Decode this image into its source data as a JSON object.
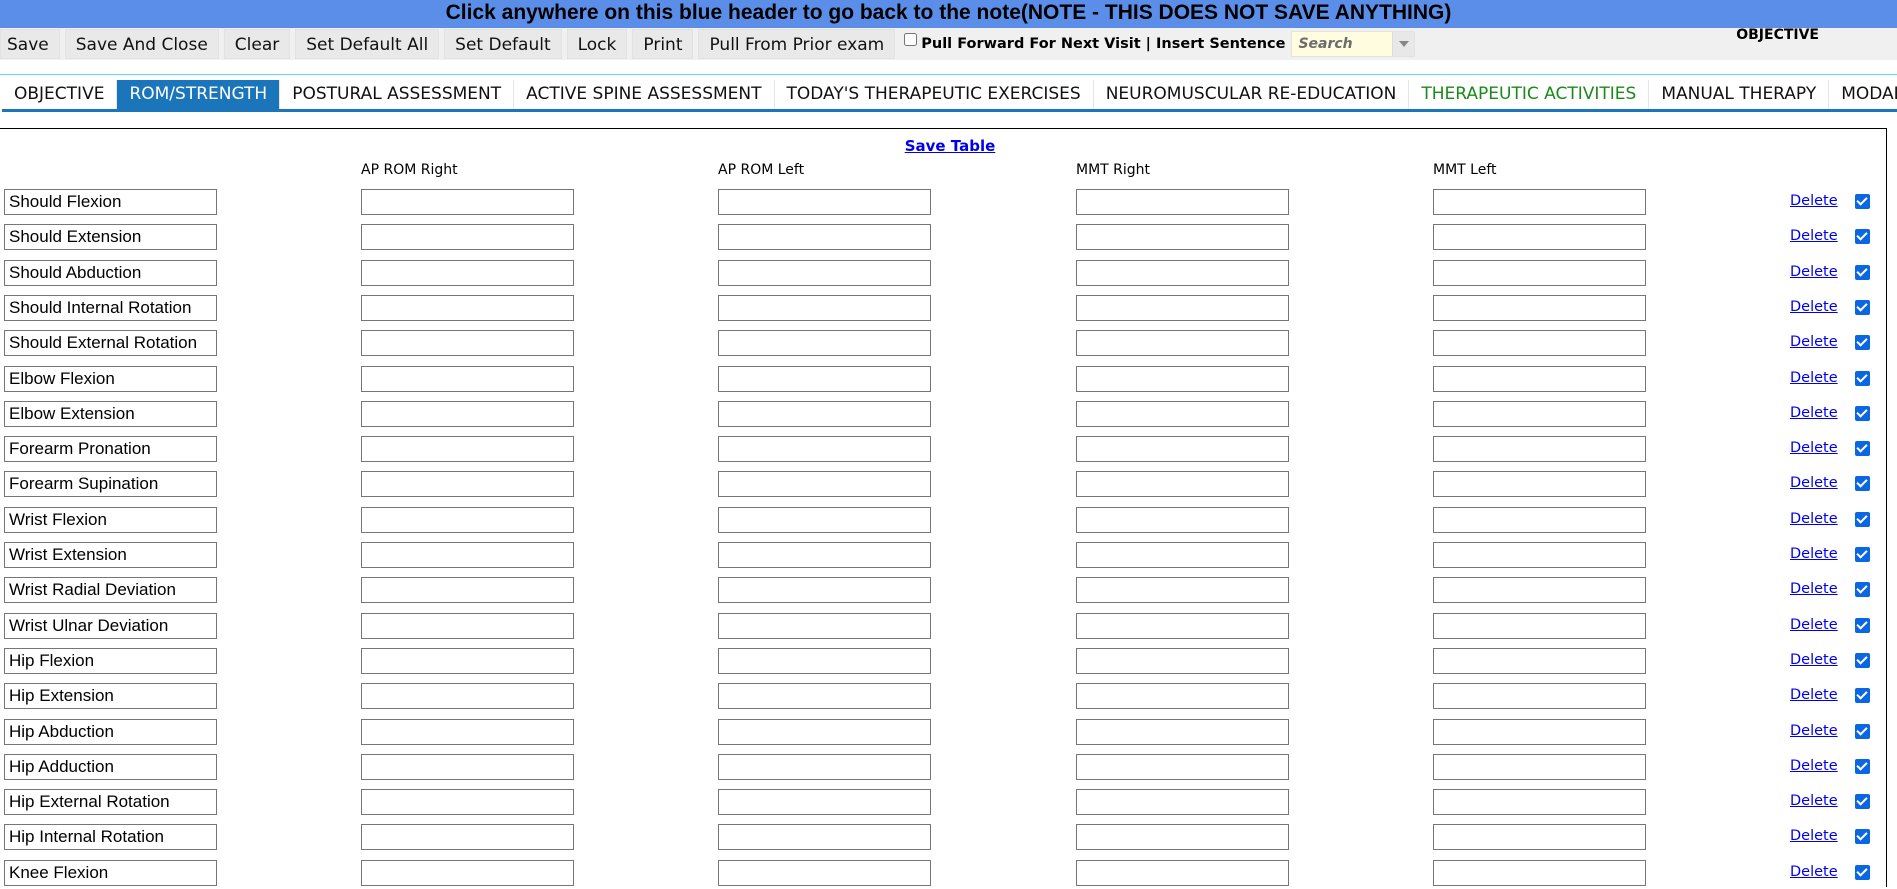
{
  "header": {
    "text": "Click anywhere on this blue header to go back to the note(NOTE - THIS DOES NOT SAVE ANYTHING)"
  },
  "toolbar": {
    "buttons": [
      "Save",
      "Save And Close",
      "Clear",
      "Set Default All",
      "Set Default",
      "Lock",
      "Print",
      "Pull From Prior exam"
    ],
    "pull_forward_label": "Pull Forward For Next Visit | Insert Sentence",
    "search_placeholder": "Search",
    "section_label": "OBJECTIVE"
  },
  "tabs": [
    {
      "label": "OBJECTIVE",
      "active": false,
      "green": false
    },
    {
      "label": "ROM/STRENGTH",
      "active": true,
      "green": false
    },
    {
      "label": "POSTURAL ASSESSMENT",
      "active": false,
      "green": false
    },
    {
      "label": "ACTIVE SPINE ASSESSMENT",
      "active": false,
      "green": false
    },
    {
      "label": "TODAY'S THERAPEUTIC EXERCISES",
      "active": false,
      "green": false
    },
    {
      "label": "NEUROMUSCULAR RE-EDUCATION",
      "active": false,
      "green": false
    },
    {
      "label": "THERAPEUTIC ACTIVITIES",
      "active": false,
      "green": true
    },
    {
      "label": "MANUAL THERAPY",
      "active": false,
      "green": false
    },
    {
      "label": "MODALITY",
      "active": false,
      "green": false
    }
  ],
  "table": {
    "save_label": "Save Table",
    "columns": [
      "AP ROM Right",
      "AP ROM Left",
      "MMT Right",
      "MMT Left"
    ],
    "delete_label": "Delete",
    "rows": [
      "Should Flexion",
      "Should Extension",
      "Should Abduction",
      "Should Internal Rotation",
      "Should External Rotation",
      "Elbow Flexion",
      "Elbow Extension",
      "Forearm Pronation",
      "Forearm Supination",
      "Wrist Flexion",
      "Wrist Extension",
      "Wrist Radial Deviation",
      "Wrist Ulnar Deviation",
      "Hip Flexion",
      "Hip Extension",
      "Hip Abduction",
      "Hip Adduction",
      "Hip External Rotation",
      "Hip Internal Rotation",
      "Knee Flexion"
    ]
  },
  "colors": {
    "header_blue": "#5b8ee8",
    "tab_active": "#1b75bb",
    "tab_green": "#1a8a1a",
    "link": "#0000ee",
    "checkbox": "#0b66e4"
  }
}
